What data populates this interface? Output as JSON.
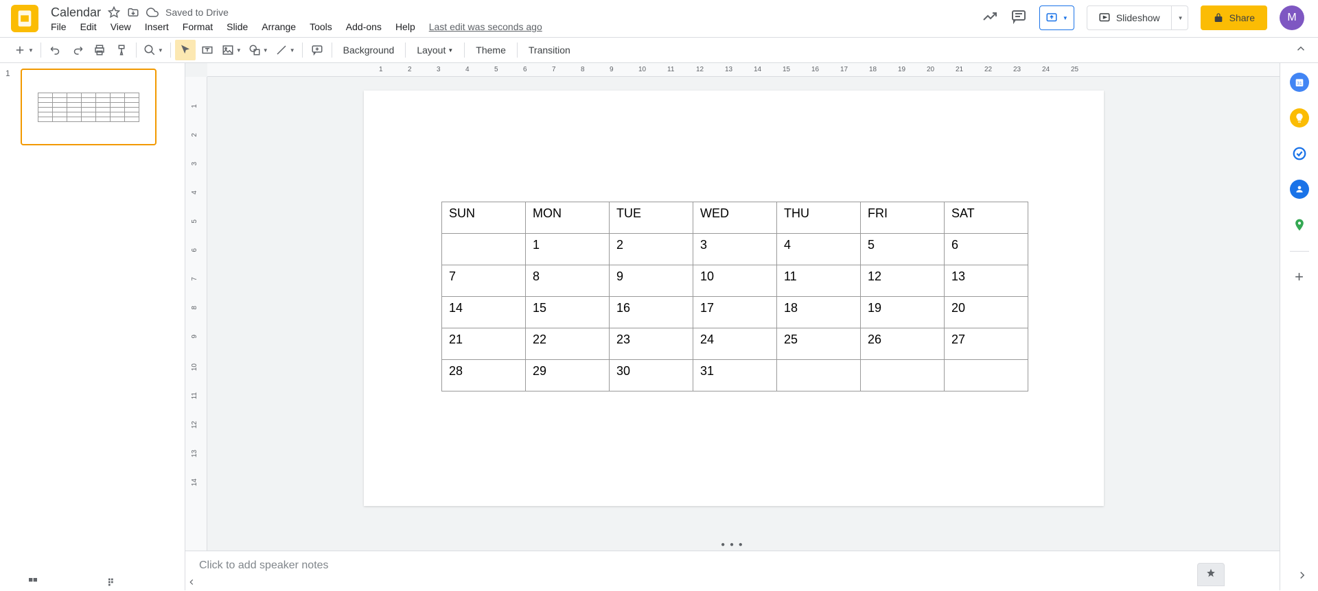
{
  "doc_title": "Calendar",
  "save_status": "Saved to Drive",
  "last_edit": "Last edit was seconds ago",
  "menu": [
    "File",
    "Edit",
    "View",
    "Insert",
    "Format",
    "Slide",
    "Arrange",
    "Tools",
    "Add-ons",
    "Help"
  ],
  "toolbar": {
    "background": "Background",
    "layout": "Layout",
    "theme": "Theme",
    "transition": "Transition"
  },
  "slideshow_label": "Slideshow",
  "share_label": "Share",
  "avatar_letter": "M",
  "slide_number": "1",
  "notes_placeholder": "Click to add speaker notes",
  "calendar": {
    "headers": [
      "SUN",
      "MON",
      "TUE",
      "WED",
      "THU",
      "FRI",
      "SAT"
    ],
    "rows": [
      [
        "",
        "1",
        "2",
        "3",
        "4",
        "5",
        "6"
      ],
      [
        "7",
        "8",
        "9",
        "10",
        "11",
        "12",
        "13"
      ],
      [
        "14",
        "15",
        "16",
        "17",
        "18",
        "19",
        "20"
      ],
      [
        "21",
        "22",
        "23",
        "24",
        "25",
        "26",
        "27"
      ],
      [
        "28",
        "29",
        "30",
        "31",
        "",
        "",
        ""
      ]
    ]
  },
  "ruler_h": [
    "1",
    "2",
    "3",
    "4",
    "5",
    "6",
    "7",
    "8",
    "9",
    "10",
    "11",
    "12",
    "13",
    "14",
    "15",
    "16",
    "17",
    "18",
    "19",
    "20",
    "21",
    "22",
    "23",
    "24",
    "25"
  ],
  "ruler_v": [
    "1",
    "2",
    "3",
    "4",
    "5",
    "6",
    "7",
    "8",
    "9",
    "10",
    "11",
    "12",
    "13",
    "14"
  ]
}
